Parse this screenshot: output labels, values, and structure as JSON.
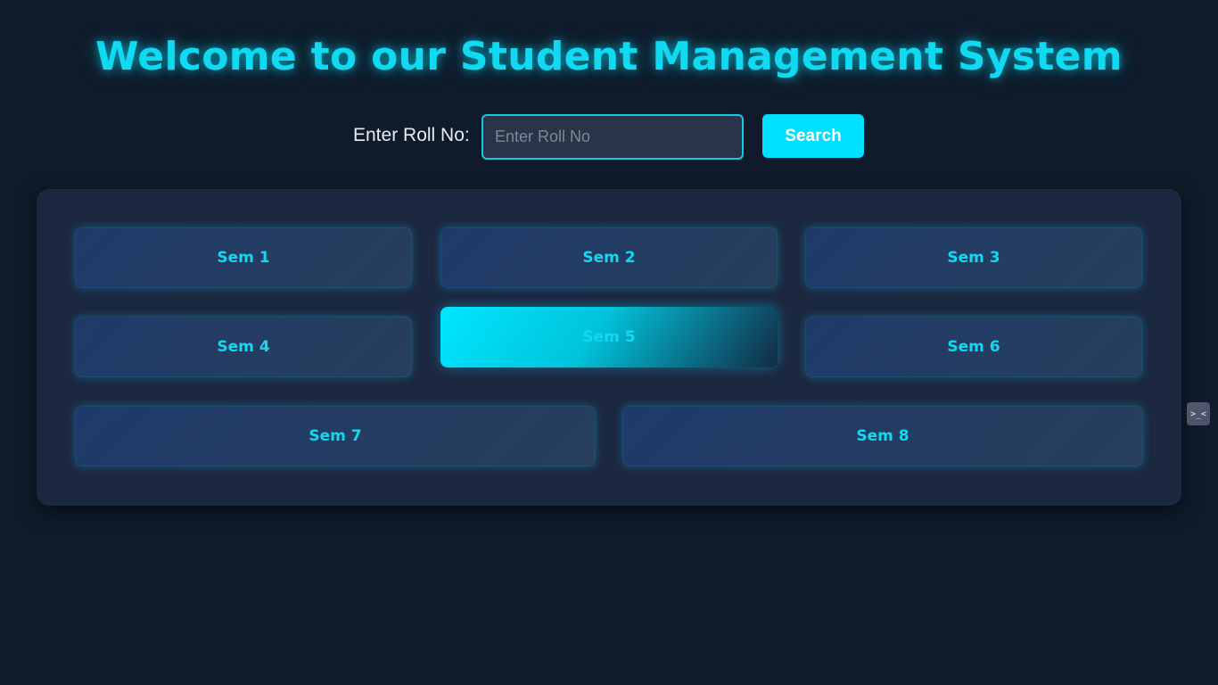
{
  "header": {
    "title": "Welcome to our Student Management System"
  },
  "search": {
    "label": "Enter Roll No:",
    "placeholder": "Enter Roll No",
    "value": "",
    "button_label": "Search"
  },
  "semesters": [
    {
      "label": "Sem 1",
      "active": false
    },
    {
      "label": "Sem 2",
      "active": false
    },
    {
      "label": "Sem 3",
      "active": false
    },
    {
      "label": "Sem 4",
      "active": false
    },
    {
      "label": "Sem 5",
      "active": true
    },
    {
      "label": "Sem 6",
      "active": false
    },
    {
      "label": "Sem 7",
      "active": false
    },
    {
      "label": "Sem 8",
      "active": false
    }
  ],
  "side_widget": {
    "icon": "terminal-face-icon",
    "glyph": ">_<"
  },
  "colors": {
    "background": "#0f1b2a",
    "accent": "#00e0ff",
    "title": "#12d9f2",
    "panel": "#1c2740"
  }
}
